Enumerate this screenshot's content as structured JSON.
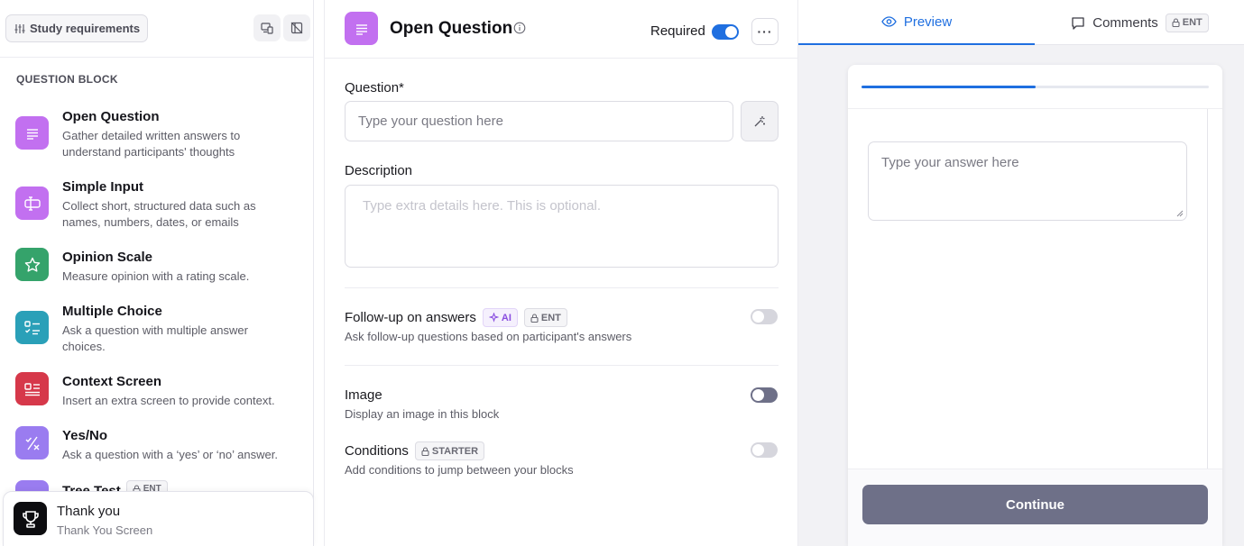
{
  "left": {
    "study_button": "Study requirements",
    "section_label": "QUESTION BLOCK",
    "blocks": [
      {
        "title": "Open Question",
        "desc": "Gather detailed written answers to understand participants' thoughts",
        "color": "#c270f0",
        "icon": "lines-icon"
      },
      {
        "title": "Simple Input",
        "desc": "Collect short, structured data such as names, numbers, dates, or emails",
        "color": "#c270f0",
        "icon": "text-cursor-icon"
      },
      {
        "title": "Opinion Scale",
        "desc": "Measure opinion with a rating scale.",
        "color": "#35a36b",
        "icon": "star-icon"
      },
      {
        "title": "Multiple Choice",
        "desc": "Ask a question with multiple answer choices.",
        "color": "#2aa0b8",
        "icon": "checklist-icon"
      },
      {
        "title": "Context Screen",
        "desc": "Insert an extra screen to provide context.",
        "color": "#d6384a",
        "icon": "article-icon"
      },
      {
        "title": "Yes/No",
        "desc": "Ask a question with a ‘yes’ or ‘no’ answer.",
        "color": "#9a7cf0",
        "icon": "yes-no-icon"
      },
      {
        "title": "Tree Test",
        "tag": "ENT",
        "color": "#9a7cf0",
        "icon": "tree-icon"
      }
    ],
    "thank_you": {
      "title": "Thank you",
      "subtitle": "Thank You Screen"
    }
  },
  "editor": {
    "title": "Open Question",
    "required_label": "Required",
    "required_on": true,
    "question_label": "Question*",
    "question_placeholder": "Type your question here",
    "description_label": "Description",
    "description_placeholder": "Type extra details here. This is optional.",
    "options": [
      {
        "title": "Follow-up on answers",
        "tags": [
          "AI",
          "ENT"
        ],
        "desc": "Ask follow-up questions based on participant's answers",
        "on": false
      },
      {
        "title": "Image",
        "tags": [],
        "desc": "Display an image in this block",
        "on": false
      },
      {
        "title": "Conditions",
        "tags": [
          "STARTER"
        ],
        "desc": "Add conditions to jump between your blocks",
        "on": false
      }
    ]
  },
  "preview": {
    "tab_preview": "Preview",
    "tab_comments": "Comments",
    "comments_tag": "ENT",
    "progress": 0.5,
    "answer_placeholder": "Type your answer here",
    "continue_label": "Continue"
  },
  "colors": {
    "accent": "#1f6fe0",
    "toggle_off": "#c9c9d1",
    "toggle_dark": "#6e7088"
  }
}
